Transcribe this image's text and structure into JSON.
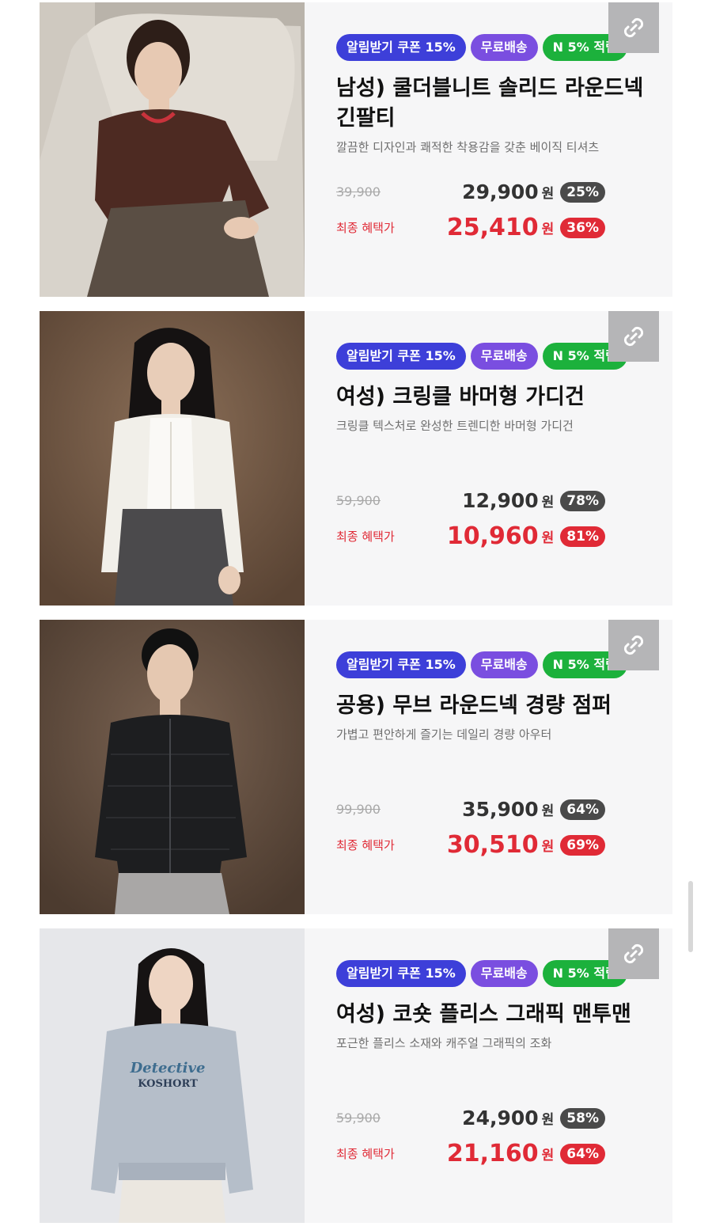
{
  "products": [
    {
      "badges": {
        "coupon": "알림받기 쿠폰 15%",
        "shipping": "무료배송",
        "points": "N 5% 적립"
      },
      "title": "남성) 쿨더블니트 솔리드 라운드넥 긴팔티",
      "description": "깔끔한 디자인과 쾌적한 착용감을 갖춘 베이직 티셔츠",
      "original_price": "39,900",
      "sale_price": "29,900",
      "currency": "원",
      "sale_discount": "25%",
      "final_label": "최종 혜택가",
      "final_price": "25,410",
      "final_discount": "36%",
      "colors": {
        "bg": "#b9b3aa",
        "chair": "#d8d3cb",
        "top": "#4d2a22",
        "pants": "#5a4e44",
        "skin": "#e7c9b3",
        "hair": "#2d1e18"
      }
    },
    {
      "badges": {
        "coupon": "알림받기 쿠폰 15%",
        "shipping": "무료배송",
        "points": "N 5% 적립"
      },
      "title": "여성) 크링클 바머형 가디건",
      "description": "크링클 텍스처로 완성한 트렌디한 바머형 가디건",
      "original_price": "59,900",
      "sale_price": "12,900",
      "currency": "원",
      "sale_discount": "78%",
      "final_label": "최종 혜택가",
      "final_price": "10,960",
      "final_discount": "81%",
      "colors": {
        "bg": "#6e5644",
        "top": "#f1efe9",
        "pants": "#4b4a4c",
        "skin": "#e8cdb8",
        "hair": "#151212"
      }
    },
    {
      "badges": {
        "coupon": "알림받기 쿠폰 15%",
        "shipping": "무료배송",
        "points": "N 5% 적립"
      },
      "title": "공용) 무브 라운드넥 경량 점퍼",
      "description": "가볍고 편안하게 즐기는 데일리 경량 아우터",
      "original_price": "99,900",
      "sale_price": "35,900",
      "currency": "원",
      "sale_discount": "64%",
      "final_label": "최종 혜택가",
      "final_price": "30,510",
      "final_discount": "69%",
      "colors": {
        "bg": "#5e4a3c",
        "top": "#1d1e20",
        "pants": "#a9a7a6",
        "skin": "#e5c8b1",
        "hair": "#111"
      }
    },
    {
      "badges": {
        "coupon": "알림받기 쿠폰 15%",
        "shipping": "무료배송",
        "points": "N 5% 적립"
      },
      "title": "여성) 코숏 플리스 그래픽 맨투맨",
      "description": "포근한 플리스 소재와 캐주얼 그래픽의 조화",
      "original_price": "59,900",
      "sale_price": "24,900",
      "currency": "원",
      "sale_discount": "58%",
      "final_label": "최종 혜택가",
      "final_price": "21,160",
      "final_discount": "64%",
      "graphic": {
        "line1": "Detective",
        "line2": "KOSHORT"
      },
      "colors": {
        "bg": "#e6e7ea",
        "top": "#b5bec9",
        "pants": "#ebe7e0",
        "skin": "#eed5c3",
        "hair": "#161313"
      }
    }
  ]
}
